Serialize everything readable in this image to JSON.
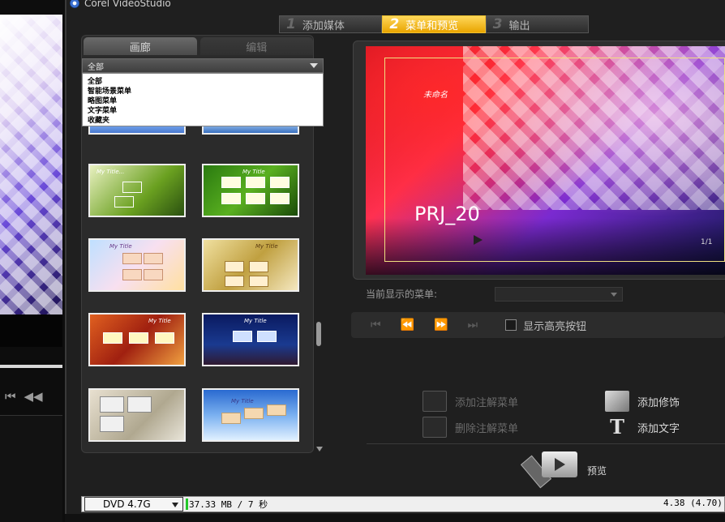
{
  "app": {
    "title": "Corel VideoStudio"
  },
  "steps": [
    {
      "num": "1",
      "label": "添加媒体",
      "active": false
    },
    {
      "num": "2",
      "label": "菜单和预览",
      "active": true
    },
    {
      "num": "3",
      "label": "输出",
      "active": false
    }
  ],
  "gallery": {
    "tabs": [
      {
        "label": "画廊",
        "active": true
      },
      {
        "label": "编辑",
        "active": false
      }
    ],
    "category_selected": "全部",
    "category_options": [
      "全部",
      "智能场景菜单",
      "略图菜单",
      "文字菜单",
      "收藏夹"
    ],
    "thumbnails": [
      {
        "name": "template-1",
        "title": ""
      },
      {
        "name": "template-2",
        "title": ""
      },
      {
        "name": "template-3",
        "title": "My Title..."
      },
      {
        "name": "template-4",
        "title": "My Title"
      },
      {
        "name": "template-5",
        "title": "My Title"
      },
      {
        "name": "template-6",
        "title": "My Title"
      },
      {
        "name": "template-7",
        "title": "My Title"
      },
      {
        "name": "template-8",
        "title": "My Title"
      },
      {
        "name": "template-9",
        "title": ""
      },
      {
        "name": "template-10",
        "title": "My Title"
      }
    ]
  },
  "preview": {
    "menu_name": "未命名",
    "project_title": "PRJ_20",
    "page_count": "1/1"
  },
  "controls": {
    "current_menu_label": "当前显示的菜单:",
    "show_highlight_label": "显示高亮按钮"
  },
  "actions": {
    "add_note_menu": "添加注解菜单",
    "delete_note_menu": "删除注解菜单",
    "add_decoration": "添加修饰",
    "add_text": "添加文字",
    "preview": "预览"
  },
  "status": {
    "disc_type": "DVD 4.7G",
    "used": "37.33 MB / 7 秒",
    "capacity": "4.38 (4.70)"
  },
  "colors": {
    "active_step": "#f0b000",
    "safe_area": "#f0e080",
    "usage_bar": "#24c82a"
  }
}
